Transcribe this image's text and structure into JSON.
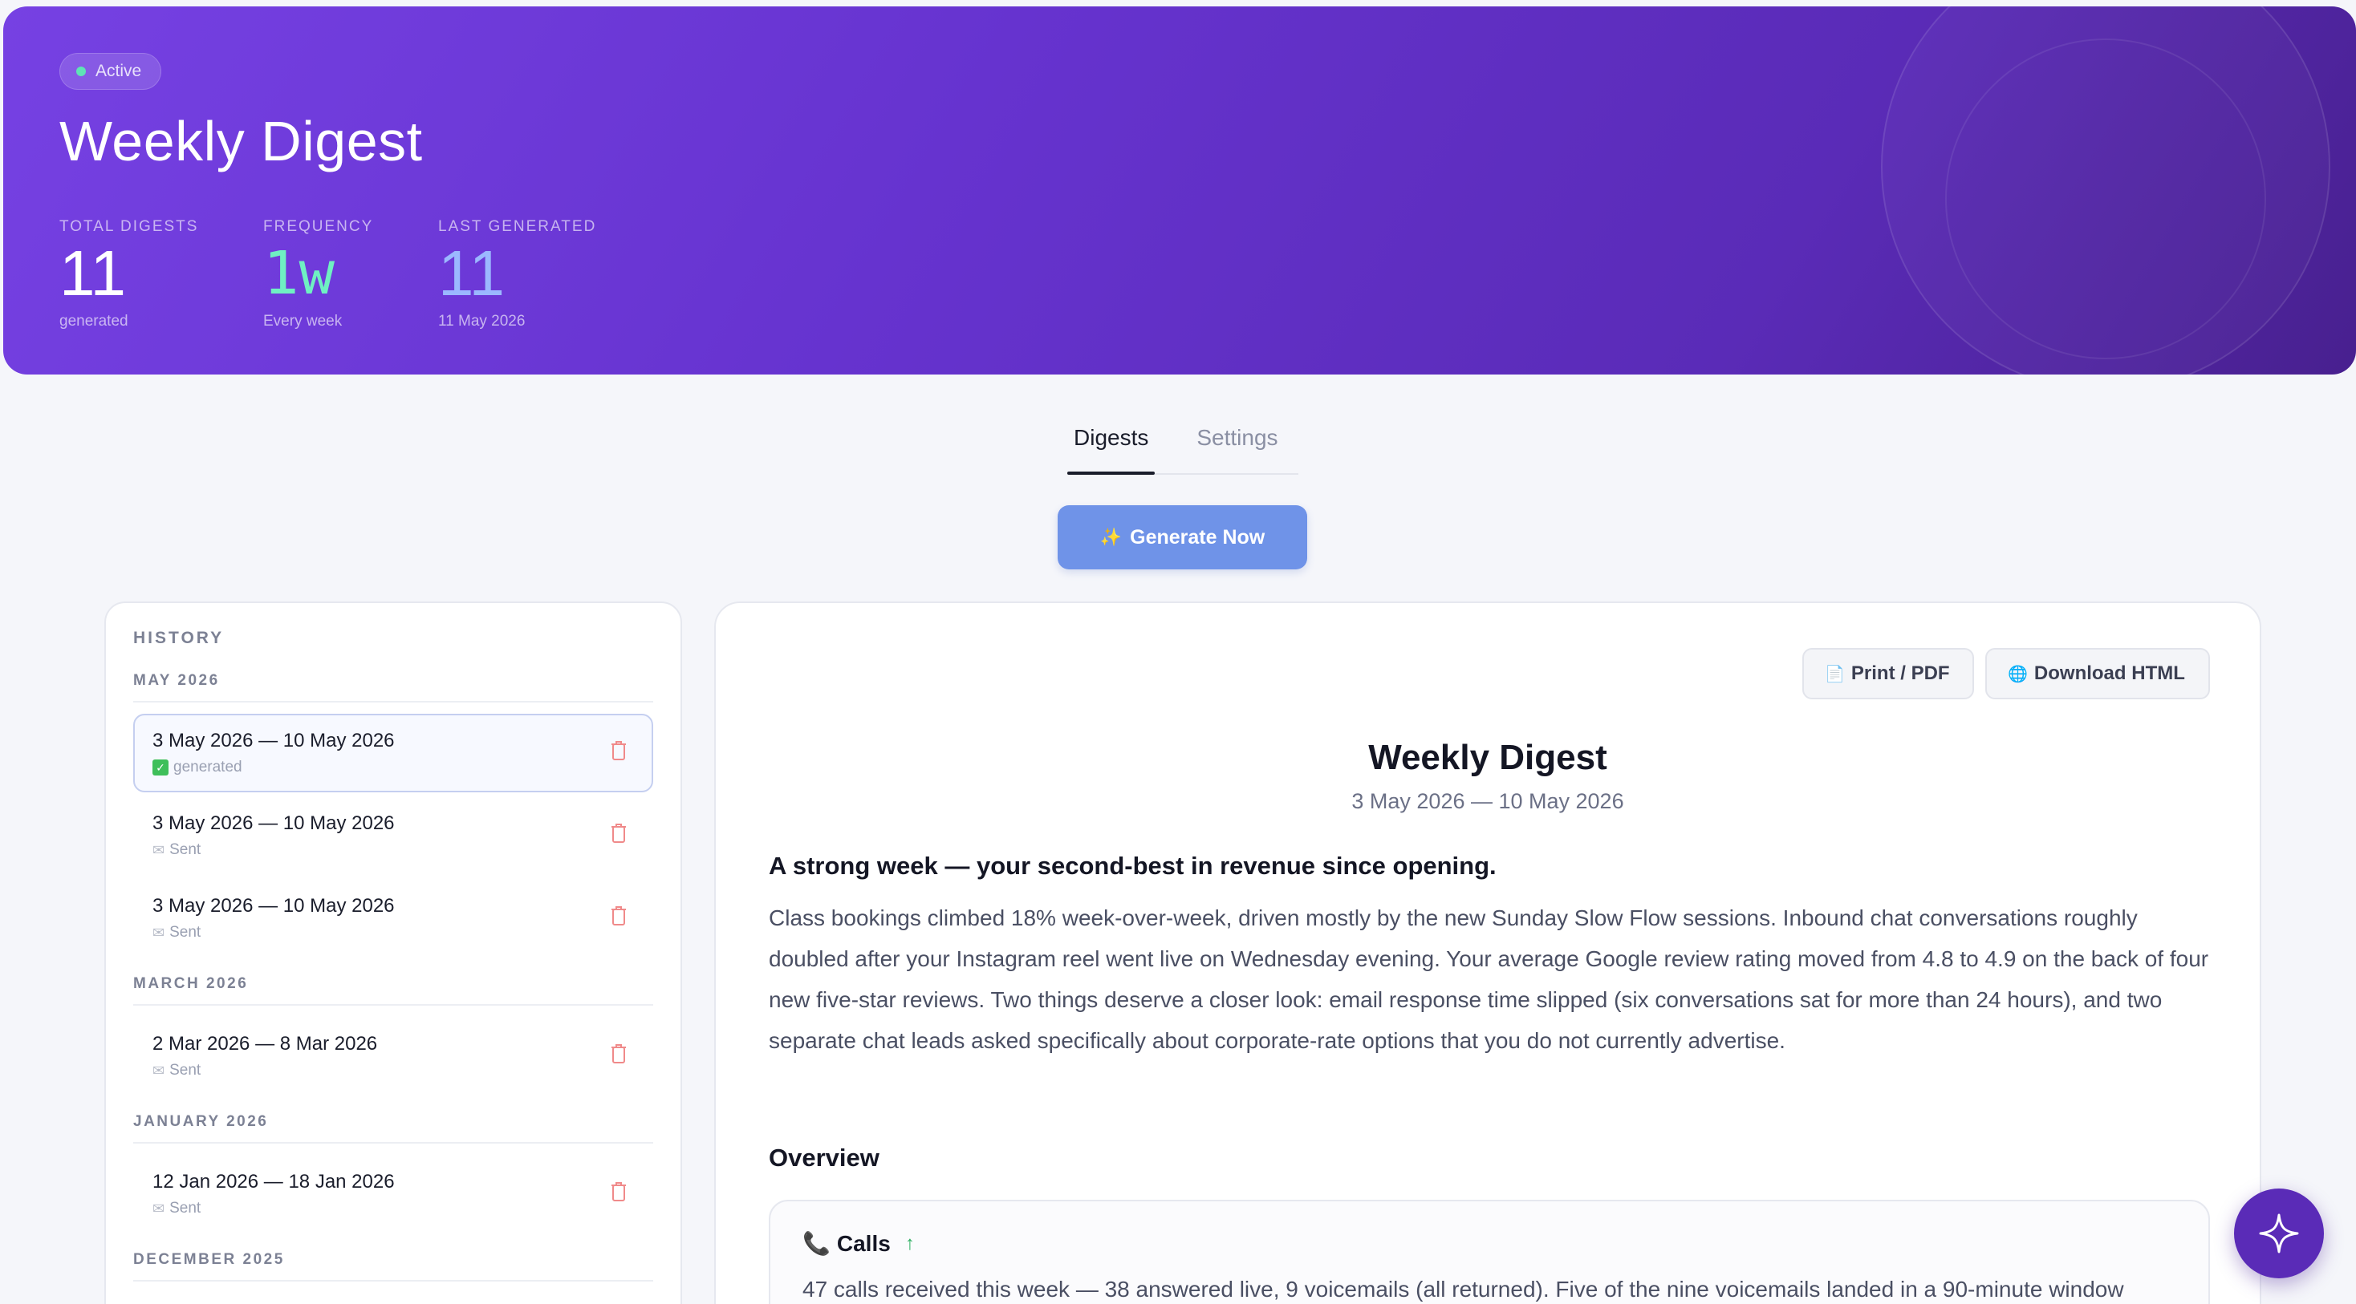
{
  "hero": {
    "status_badge": "Active",
    "title": "Weekly Digest",
    "stats": [
      {
        "label": "TOTAL DIGESTS",
        "value": "11",
        "sub": "generated"
      },
      {
        "label": "FREQUENCY",
        "value": "1w",
        "sub": "Every week"
      },
      {
        "label": "LAST GENERATED",
        "value": "11",
        "sub": "11 May 2026"
      }
    ]
  },
  "tabs": [
    {
      "label": "Digests",
      "active": true
    },
    {
      "label": "Settings",
      "active": false
    }
  ],
  "actions": {
    "generate_label": "Generate Now",
    "generate_icon": "sparkles-icon"
  },
  "history": {
    "title": "HISTORY",
    "groups": [
      {
        "label": "MAY 2026",
        "entries": [
          {
            "range": "3 May 2026 — 10 May 2026",
            "status": "generated",
            "status_icon": "check-icon",
            "selected": true
          },
          {
            "range": "3 May 2026 — 10 May 2026",
            "status": "Sent",
            "status_icon": "mail-icon"
          },
          {
            "range": "3 May 2026 — 10 May 2026",
            "status": "Sent",
            "status_icon": "mail-icon"
          }
        ]
      },
      {
        "label": "MARCH 2026",
        "entries": [
          {
            "range": "2 Mar 2026 — 8 Mar 2026",
            "status": "Sent",
            "status_icon": "mail-icon"
          }
        ]
      },
      {
        "label": "JANUARY 2026",
        "entries": [
          {
            "range": "12 Jan 2026 — 18 Jan 2026",
            "status": "Sent",
            "status_icon": "mail-icon"
          }
        ]
      },
      {
        "label": "DECEMBER 2025",
        "entries": []
      }
    ]
  },
  "digest": {
    "print_label": "Print / PDF",
    "download_label": "Download HTML",
    "title": "Weekly Digest",
    "range": "3 May 2026 — 10 May 2026",
    "lead": "A strong week — your second-best in revenue since opening.",
    "body": "Class bookings climbed 18% week-over-week, driven mostly by the new Sunday Slow Flow sessions. Inbound chat conversations roughly doubled after your Instagram reel went live on Wednesday evening. Your average Google review rating moved from 4.8 to 4.9 on the back of four new five-star reviews. Two things deserve a closer look: email response time slipped (six conversations sat for more than 24 hours), and two separate chat leads asked specifically about corporate-rate options that you do not currently advertise.",
    "overview_heading": "Overview",
    "calls": {
      "title": "Calls",
      "trend": "up",
      "text": "47 calls received this week — 38 answered live, 9 voicemails (all returned). Five of the nine voicemails landed in a 90-minute window"
    }
  },
  "colors": {
    "hero_start": "#7641e3",
    "hero_end": "#48208f",
    "accent_button": "#6f93e8",
    "active_dot": "#5fe3b6",
    "trash": "#f08a8a"
  }
}
